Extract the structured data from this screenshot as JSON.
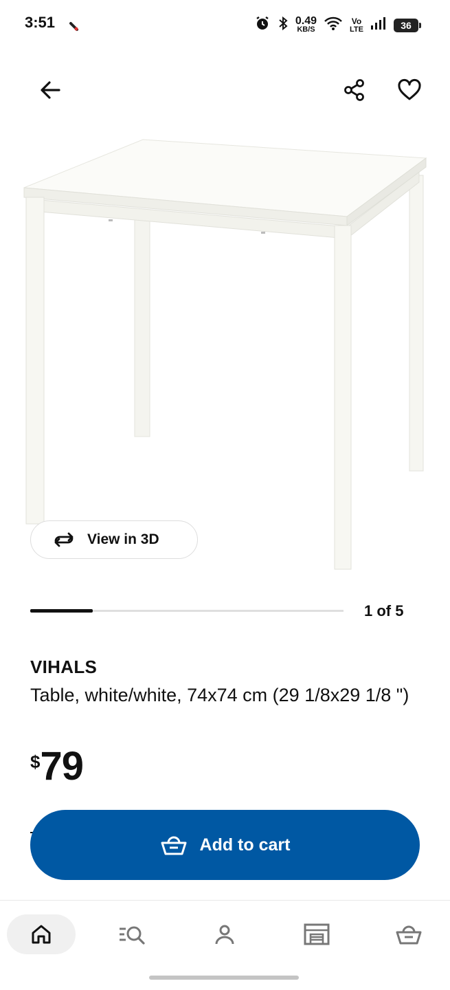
{
  "status_bar": {
    "time": "3:51",
    "network_speed_value": "0.49",
    "network_speed_unit": "KB/S",
    "volte_label_top": "Vo",
    "volte_label_bottom": "LTE",
    "battery": "36"
  },
  "header": {
    "back_icon": "arrow-left-icon",
    "share_icon": "share-icon",
    "favorite_icon": "heart-icon"
  },
  "product": {
    "view_3d_label": "View in 3D",
    "carousel": {
      "page_text": "1 of 5",
      "current": 1,
      "total": 5,
      "progress_fraction": 0.2
    },
    "name": "VIHALS",
    "description": "Table, white/white, 74x74 cm (29 1/8x29 1/8 \")",
    "price_currency": "$",
    "price_value": "79",
    "add_to_cart_label": "Add to cart",
    "accent_color": "#0058a3"
  },
  "bottom_nav": {
    "items": [
      {
        "icon": "home-icon",
        "active": true
      },
      {
        "icon": "search-list-icon",
        "active": false
      },
      {
        "icon": "profile-icon",
        "active": false
      },
      {
        "icon": "store-icon",
        "active": false
      },
      {
        "icon": "cart-icon",
        "active": false
      }
    ]
  }
}
